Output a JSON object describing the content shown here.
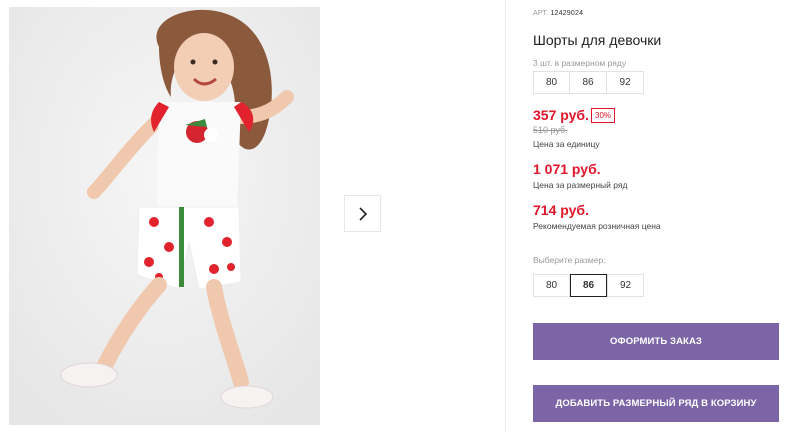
{
  "product": {
    "article": "АРТ.",
    "article_number": "12429024",
    "title": "Шорты для девочки",
    "row_sizes_label": "3 шт. в размерном ряду",
    "row_sizes": [
      "80",
      "86",
      "92"
    ],
    "price_unit": "357 руб.",
    "discount_badge": "30%",
    "old_price": "510 руб.",
    "price_unit_caption": "Цена за единицу",
    "price_row": "1 071 руб.",
    "price_row_caption": "Цена за размерный ряд",
    "price_retail": "714 руб.",
    "price_retail_caption": "Рекомендуемая розничная цена",
    "choose_size_label": "Выберите размер:",
    "choose_sizes": [
      "80",
      "86",
      "92"
    ],
    "selected_size": "86",
    "order_button": "ОФОРМИТЬ ЗАКАЗ",
    "add_row_button": "ДОБАВИТЬ РАЗМЕРНЫЙ РЯД В КОРЗИНУ"
  },
  "colors": {
    "accent": "#7b65a6",
    "price": "#e0162b"
  },
  "icons": {
    "gallery_next": "chevron-right-icon"
  }
}
